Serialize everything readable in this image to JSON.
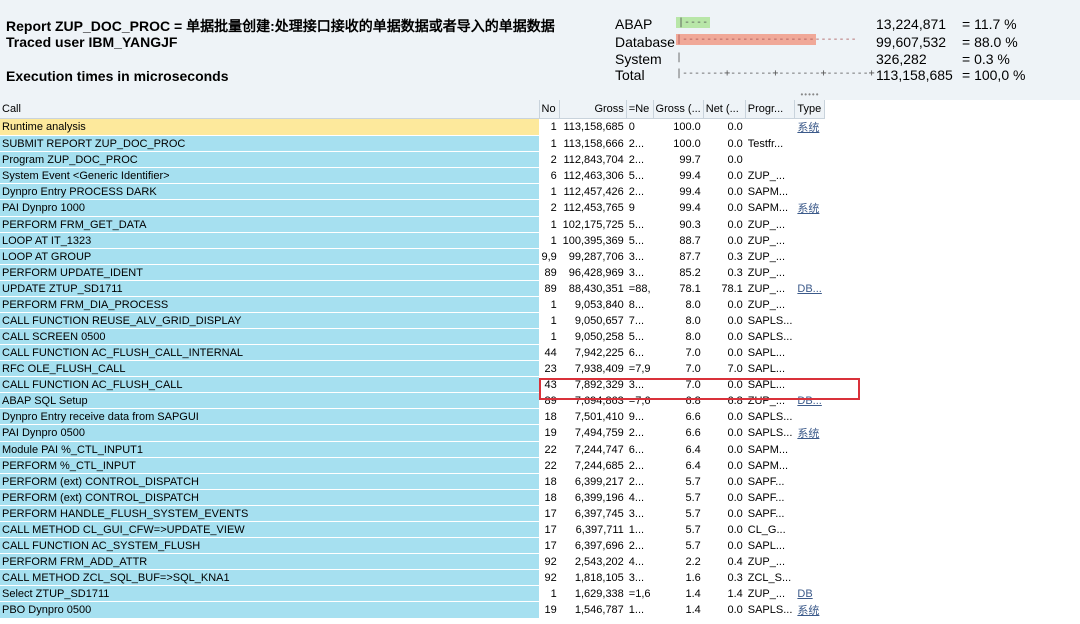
{
  "header": {
    "title": "Report ZUP_DOC_PROC = 单据批量创建:处理接口接收的单据数据或者导入的单据数据",
    "traced_user": "Traced user IBM_YANGJF",
    "units": "Execution times in microseconds"
  },
  "summary": [
    {
      "label": "ABAP",
      "bar": "|----",
      "value": "13,224,871",
      "percent": "=  11.7 %"
    },
    {
      "label": "Database",
      "bar": "|-----------------------------",
      "value": "99,607,532",
      "percent": "=  88.0 %"
    },
    {
      "label": "System",
      "bar": "|",
      "value": "326,282",
      "percent": "=  0.3 %"
    },
    {
      "label": "Total",
      "bar": "|-------+-------+-------+-------+",
      "value": "113,158,685",
      "percent": "=  100,0 %"
    }
  ],
  "grid": {
    "columns": [
      "Call",
      "No",
      "Gross",
      "=Ne",
      "Gross (...",
      "Net (...",
      "Progr...",
      "Type"
    ],
    "rows": [
      {
        "call": "Runtime analysis",
        "no": "1",
        "gross": "113,158,685",
        "ne": "0",
        "gross_pct": "100.0",
        "net_pct": "0.0",
        "prog": "",
        "type": "系统"
      },
      {
        "call": "SUBMIT REPORT ZUP_DOC_PROC",
        "no": "1",
        "gross": "113,158,666",
        "ne": "2...",
        "gross_pct": "100.0",
        "net_pct": "0.0",
        "prog": "Testfr...",
        "type": ""
      },
      {
        "call": "Program ZUP_DOC_PROC",
        "no": "2",
        "gross": "112,843,704",
        "ne": "2...",
        "gross_pct": "99.7",
        "net_pct": "0.0",
        "prog": "",
        "type": ""
      },
      {
        "call": "System Event <Generic Identifier>",
        "no": "6",
        "gross": "112,463,306",
        "ne": "5...",
        "gross_pct": "99.4",
        "net_pct": "0.0",
        "prog": "ZUP_...",
        "type": ""
      },
      {
        "call": "Dynpro Entry PROCESS DARK",
        "no": "1",
        "gross": "112,457,426",
        "ne": "2...",
        "gross_pct": "99.4",
        "net_pct": "0.0",
        "prog": "SAPM...",
        "type": ""
      },
      {
        "call": "PAI Dynpro 1000",
        "no": "2",
        "gross": "112,453,765",
        "ne": "9",
        "gross_pct": "99.4",
        "net_pct": "0.0",
        "prog": "SAPM...",
        "type": "系统"
      },
      {
        "call": "PERFORM FRM_GET_DATA",
        "no": "1",
        "gross": "102,175,725",
        "ne": "5...",
        "gross_pct": "90.3",
        "net_pct": "0.0",
        "prog": "ZUP_...",
        "type": ""
      },
      {
        "call": "LOOP AT IT_1323",
        "no": "1",
        "gross": "100,395,369",
        "ne": "5...",
        "gross_pct": "88.7",
        "net_pct": "0.0",
        "prog": "ZUP_...",
        "type": ""
      },
      {
        "call": "LOOP AT GROUP",
        "no": "9,9",
        "gross": "99,287,706",
        "ne": "3...",
        "gross_pct": "87.7",
        "net_pct": "0.3",
        "prog": "ZUP_...",
        "type": ""
      },
      {
        "call": "PERFORM UPDATE_IDENT",
        "no": "89",
        "gross": "96,428,969",
        "ne": "3...",
        "gross_pct": "85.2",
        "net_pct": "0.3",
        "prog": "ZUP_...",
        "type": ""
      },
      {
        "call": "UPDATE ZTUP_SD1711",
        "no": "89",
        "gross": "88,430,351",
        "ne": "=88,",
        "gross_pct": "78.1",
        "net_pct": "78.1",
        "prog": "ZUP_...",
        "type": "DB..."
      },
      {
        "call": "PERFORM FRM_DIA_PROCESS",
        "no": "1",
        "gross": "9,053,840",
        "ne": "8...",
        "gross_pct": "8.0",
        "net_pct": "0.0",
        "prog": "ZUP_...",
        "type": ""
      },
      {
        "call": "CALL FUNCTION REUSE_ALV_GRID_DISPLAY",
        "no": "1",
        "gross": "9,050,657",
        "ne": "7...",
        "gross_pct": "8.0",
        "net_pct": "0.0",
        "prog": "SAPLS...",
        "type": ""
      },
      {
        "call": "CALL SCREEN 0500",
        "no": "1",
        "gross": "9,050,258",
        "ne": "5...",
        "gross_pct": "8.0",
        "net_pct": "0.0",
        "prog": "SAPLS...",
        "type": ""
      },
      {
        "call": "CALL FUNCTION AC_FLUSH_CALL_INTERNAL",
        "no": "44",
        "gross": "7,942,225",
        "ne": "6...",
        "gross_pct": "7.0",
        "net_pct": "0.0",
        "prog": "SAPL...",
        "type": ""
      },
      {
        "call": "RFC OLE_FLUSH_CALL",
        "no": "23",
        "gross": "7,938,409",
        "ne": "=7,9",
        "gross_pct": "7.0",
        "net_pct": "7.0",
        "prog": "SAPL...",
        "type": ""
      },
      {
        "call": "CALL FUNCTION AC_FLUSH_CALL",
        "no": "43",
        "gross": "7,892,329",
        "ne": "3...",
        "gross_pct": "7.0",
        "net_pct": "0.0",
        "prog": "SAPL...",
        "type": ""
      },
      {
        "call": "ABAP SQL Setup",
        "no": "89",
        "gross": "7,694,863",
        "ne": "=7,6",
        "gross_pct": "6.8",
        "net_pct": "6.8",
        "prog": "ZUP_...",
        "type": "DB..."
      },
      {
        "call": "Dynpro Entry receive data from SAPGUI",
        "no": "18",
        "gross": "7,501,410",
        "ne": "9...",
        "gross_pct": "6.6",
        "net_pct": "0.0",
        "prog": "SAPLS...",
        "type": ""
      },
      {
        "call": "PAI Dynpro 0500",
        "no": "19",
        "gross": "7,494,759",
        "ne": "2...",
        "gross_pct": "6.6",
        "net_pct": "0.0",
        "prog": "SAPLS...",
        "type": "系统"
      },
      {
        "call": "Module PAI %_CTL_INPUT1",
        "no": "22",
        "gross": "7,244,747",
        "ne": "6...",
        "gross_pct": "6.4",
        "net_pct": "0.0",
        "prog": "SAPM...",
        "type": ""
      },
      {
        "call": "PERFORM %_CTL_INPUT",
        "no": "22",
        "gross": "7,244,685",
        "ne": "2...",
        "gross_pct": "6.4",
        "net_pct": "0.0",
        "prog": "SAPM...",
        "type": ""
      },
      {
        "call": "PERFORM (ext) CONTROL_DISPATCH",
        "no": "18",
        "gross": "6,399,217",
        "ne": "2...",
        "gross_pct": "5.7",
        "net_pct": "0.0",
        "prog": "SAPF...",
        "type": ""
      },
      {
        "call": "PERFORM (ext) CONTROL_DISPATCH",
        "no": "18",
        "gross": "6,399,196",
        "ne": "4...",
        "gross_pct": "5.7",
        "net_pct": "0.0",
        "prog": "SAPF...",
        "type": ""
      },
      {
        "call": "PERFORM HANDLE_FLUSH_SYSTEM_EVENTS",
        "no": "17",
        "gross": "6,397,745",
        "ne": "3...",
        "gross_pct": "5.7",
        "net_pct": "0.0",
        "prog": "SAPF...",
        "type": ""
      },
      {
        "call": "CALL METHOD CL_GUI_CFW=>UPDATE_VIEW",
        "no": "17",
        "gross": "6,397,711",
        "ne": "1...",
        "gross_pct": "5.7",
        "net_pct": "0.0",
        "prog": "CL_G...",
        "type": ""
      },
      {
        "call": "CALL FUNCTION AC_SYSTEM_FLUSH",
        "no": "17",
        "gross": "6,397,696",
        "ne": "2...",
        "gross_pct": "5.7",
        "net_pct": "0.0",
        "prog": "SAPL...",
        "type": ""
      },
      {
        "call": "PERFORM FRM_ADD_ATTR",
        "no": "92",
        "gross": "2,543,202",
        "ne": "4...",
        "gross_pct": "2.2",
        "net_pct": "0.4",
        "prog": "ZUP_...",
        "type": ""
      },
      {
        "call": "CALL METHOD ZCL_SQL_BUF=>SQL_KNA1",
        "no": "92",
        "gross": "1,818,105",
        "ne": "3...",
        "gross_pct": "1.6",
        "net_pct": "0.3",
        "prog": "ZCL_S...",
        "type": ""
      },
      {
        "call": "Select ZTUP_SD1711",
        "no": "1",
        "gross": "1,629,338",
        "ne": "=1,6",
        "gross_pct": "1.4",
        "net_pct": "1.4",
        "prog": "ZUP_...",
        "type": "DB"
      },
      {
        "call": "PBO Dynpro 0500",
        "no": "19",
        "gross": "1,546,787",
        "ne": "1...",
        "gross_pct": "1.4",
        "net_pct": "0.0",
        "prog": "SAPLS...",
        "type": "系统"
      }
    ]
  }
}
